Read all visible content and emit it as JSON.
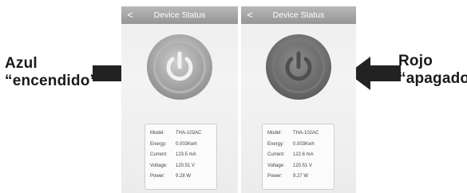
{
  "annotations": {
    "left": {
      "line1": "Azul",
      "line2": "“encendido”"
    },
    "right": {
      "line1": "Rojo",
      "line2": "“apagado”"
    }
  },
  "screens": [
    {
      "title": "Device Status",
      "back": "<",
      "state": "on",
      "icon": "power-icon",
      "rows": [
        {
          "label": "Model:",
          "value": "THA-103AC"
        },
        {
          "label": "Energy:",
          "value": "0.003Kwh"
        },
        {
          "label": "Current:",
          "value": "123.5 mA"
        },
        {
          "label": "Voltage:",
          "value": "120.51 V"
        },
        {
          "label": "Power:",
          "value": "9.28 W"
        }
      ]
    },
    {
      "title": "Device Status",
      "back": "<",
      "state": "off",
      "icon": "power-icon",
      "rows": [
        {
          "label": "Model:",
          "value": "THA-102AC"
        },
        {
          "label": "Energy:",
          "value": "0.003Kwh"
        },
        {
          "label": "Current:",
          "value": "122.6 mA"
        },
        {
          "label": "Voltage:",
          "value": "120.51 V"
        },
        {
          "label": "Power:",
          "value": "9.27 W"
        }
      ]
    }
  ],
  "colors": {
    "on_button": "#a8a8a8",
    "off_button": "#7a7a7a",
    "arrow": "#222222"
  }
}
